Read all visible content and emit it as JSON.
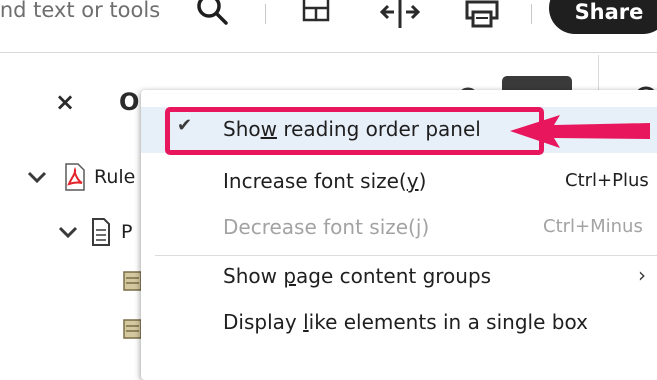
{
  "toolbar": {
    "search_text": "ind text or tools",
    "share_label": "Share"
  },
  "panel": {
    "title": "O",
    "close_glyph": "×",
    "tree": [
      {
        "label": "Rule"
      },
      {
        "label": "P"
      }
    ]
  },
  "menu": {
    "items": [
      {
        "label_pre": "Sho",
        "label_mnemonic": "w",
        "label_post": " reading order panel",
        "checked": true,
        "shortcut": "",
        "submenu": false,
        "disabled": false
      },
      {
        "label_pre": "Increase font size(",
        "label_mnemonic": "y",
        "label_post": ")",
        "checked": false,
        "shortcut": "Ctrl+Plus",
        "submenu": false,
        "disabled": false
      },
      {
        "label_pre": "Decrease font size(",
        "label_mnemonic": "j",
        "label_post": ")",
        "checked": false,
        "shortcut": "Ctrl+Minus",
        "submenu": false,
        "disabled": true
      },
      {
        "label_pre": "Show ",
        "label_mnemonic": "p",
        "label_post": "age content groups",
        "checked": false,
        "shortcut": "",
        "submenu": true,
        "disabled": false
      },
      {
        "label_pre": "Display ",
        "label_mnemonic": "l",
        "label_post": "ike elements in a single box",
        "checked": false,
        "shortcut": "",
        "submenu": false,
        "disabled": false
      }
    ],
    "check_glyph": "✔",
    "submenu_glyph": "›"
  },
  "annotation": {
    "color": "#e8175d"
  }
}
